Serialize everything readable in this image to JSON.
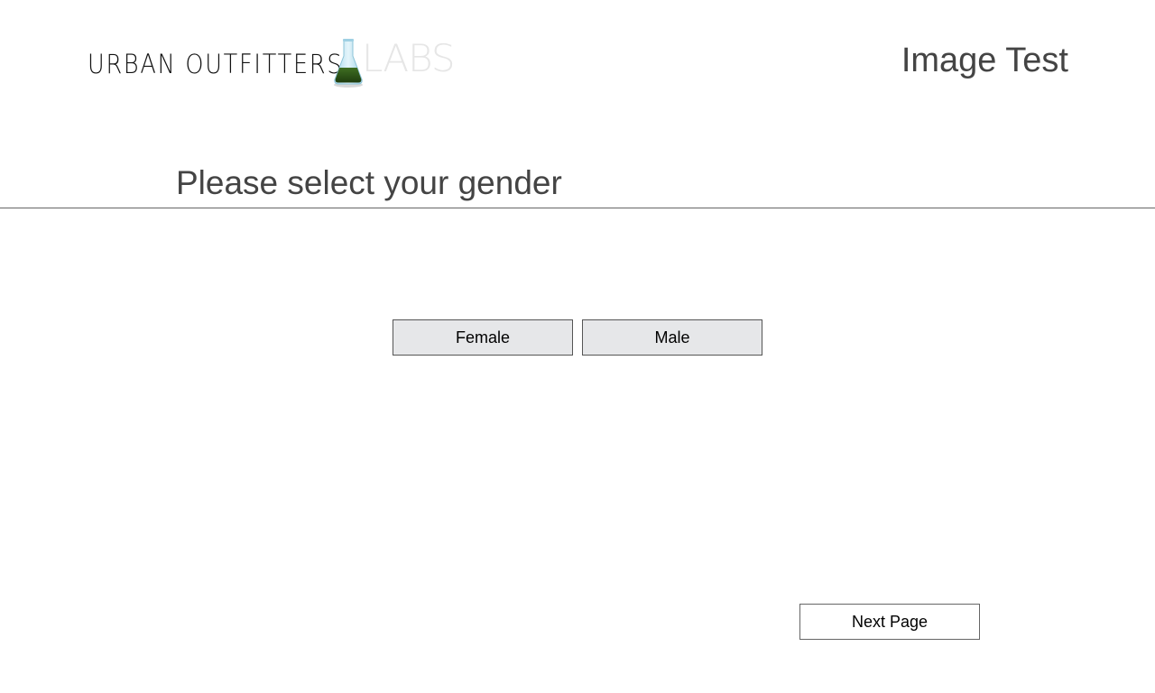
{
  "header": {
    "logo_wordmark": "URBAN OUTFITTERS",
    "logo_suffix": "LABS",
    "logo_icon": "flask-icon",
    "title": "Image Test"
  },
  "main": {
    "question": "Please select your gender",
    "options": [
      {
        "label": "Female"
      },
      {
        "label": "Male"
      }
    ]
  },
  "footer": {
    "next_label": "Next Page"
  },
  "colors": {
    "heading_text": "#444444",
    "button_fill": "#e6e7e9",
    "flask_liquid": "#2f5a1a",
    "flask_glass": "#bfe3ef",
    "labs_text": "#e6e6e6"
  }
}
